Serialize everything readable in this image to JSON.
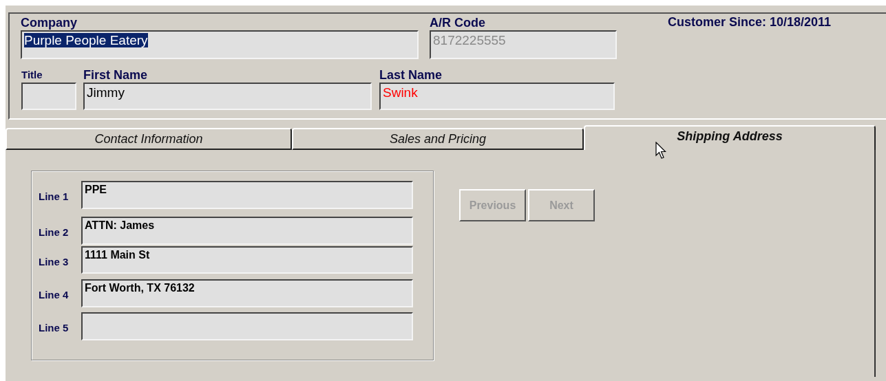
{
  "header": {
    "fields": [
      {
        "kind": "company",
        "label": "Company",
        "value": "Purple People Eatery",
        "highlighted": true
      },
      {
        "kind": "ar_code",
        "label": "A/R Code",
        "value": "8172225555",
        "disabled": true
      },
      {
        "kind": "title",
        "label": "Title"
      },
      {
        "kind": "first_name",
        "label": "First Name",
        "value": "Jimmy"
      },
      {
        "kind": "last_name",
        "label": "Last Name",
        "value": "Swink",
        "color": "#ff0000"
      }
    ],
    "customer_since": "Customer Since: 10/18/2011"
  },
  "tabs": [
    {
      "label": "Contact Information",
      "selected": false
    },
    {
      "label": "Sales and Pricing",
      "selected": false
    },
    {
      "label": "Shipping Address",
      "selected": true
    }
  ],
  "address_lines": [
    {
      "label": "Line 1",
      "value": "PPE"
    },
    {
      "label": "Line 2",
      "value": "ATTN: James"
    },
    {
      "label": "Line 3",
      "value": "1111 Main St"
    },
    {
      "label": "Line 4",
      "value": "Fort Worth, TX 76132"
    },
    {
      "label": "Line 5"
    }
  ],
  "buttons": [
    {
      "label": "Previous",
      "disabled": true
    },
    {
      "label": "Next",
      "disabled": true
    }
  ]
}
